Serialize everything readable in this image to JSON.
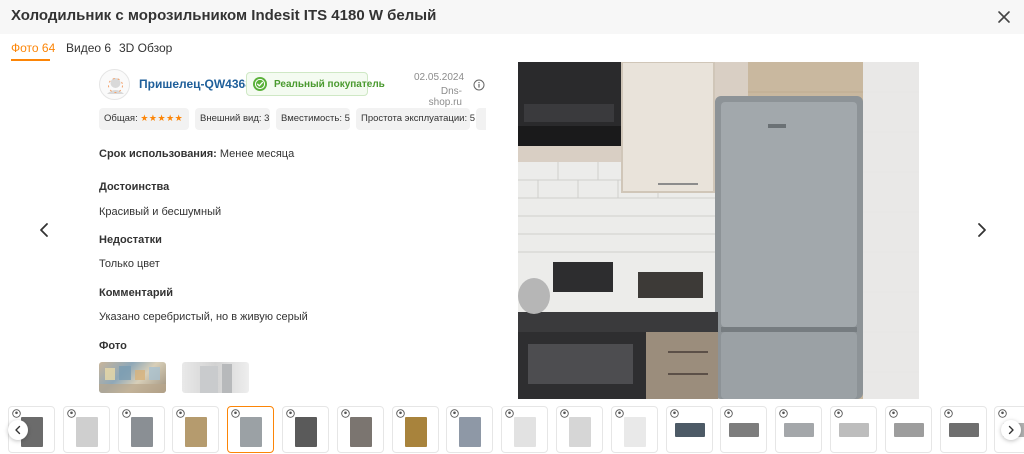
{
  "product": {
    "title": "Холодильник с морозильником Indesit ITS 4180 W белый"
  },
  "tabs": [
    {
      "label": "Фото 64",
      "active": true
    },
    {
      "label": "Видео 6",
      "active": false
    },
    {
      "label": "3D Обзор",
      "active": false
    }
  ],
  "review": {
    "author": "Пришелец-QW43687",
    "badge": "Реальный покупатель",
    "date": "02.05.2024",
    "source": "Dns-shop.ru",
    "ratings": [
      {
        "label": "Общая:",
        "stars": 5
      },
      {
        "label": "Внешний вид: 3"
      },
      {
        "label": "Вместимость: 5"
      },
      {
        "label": "Простота эксплуатации: 5"
      }
    ],
    "usage_label": "Срок использования:",
    "usage_value": "Менее месяца",
    "pros_title": "Достоинства",
    "pros_text": "Красивый и бесшумный",
    "cons_title": "Недостатки",
    "cons_text": "Только цвет",
    "comment_title": "Комментарий",
    "comment_text": "Указано серебристый, но в живую серый",
    "photos_title": "Фото"
  },
  "icons": {
    "close": "close-icon",
    "prev": "chevron-left-icon",
    "next": "chevron-right-icon",
    "info": "info-icon",
    "verified": "check-badge-icon",
    "thumb_user": "user-icon"
  },
  "colors": {
    "accent": "#fc8507",
    "link": "#1f5f9a",
    "verified_green": "#4a9a2f",
    "star": "#fc8507"
  },
  "thumbnails": {
    "count": 19,
    "active_index": 4
  }
}
